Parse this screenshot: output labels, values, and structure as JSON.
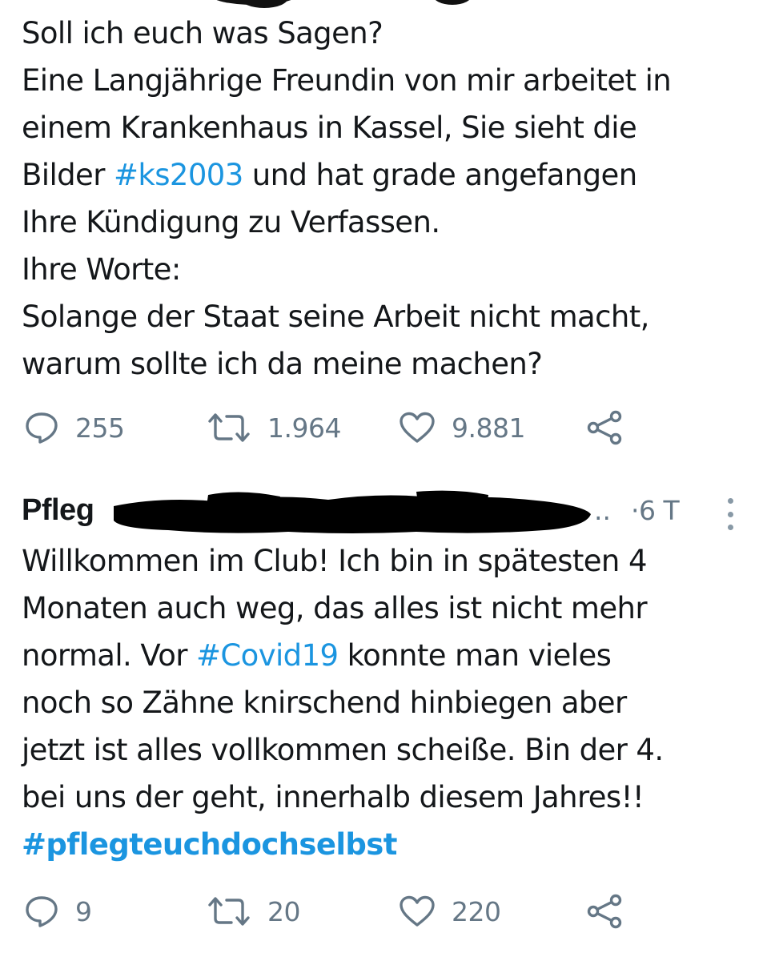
{
  "tweet1": {
    "text_lines": [
      "Soll ich euch was Sagen?",
      "Eine Langjährige Freundin von mir arbeitet in",
      "einem Krankenhaus in Kassel, Sie sieht die",
      "Bilder ",
      "#ks2003",
      " und hat grade angefangen",
      "Ihre Kündigung zu Verfassen.",
      "Ihre Worte:",
      "Solange der Staat seine Arbeit nicht macht,",
      "warum sollte ich da meine machen?"
    ],
    "hashtag": "#ks2003",
    "replies": "255",
    "retweets": "1.964",
    "likes": "9.881"
  },
  "tweet2": {
    "author": "Pfleg",
    "ellipsis": "..",
    "time": "·6 T",
    "text_lines": [
      "Willkommen im Club! Ich bin in spätesten 4",
      "Monaten auch weg, das alles ist nicht mehr",
      "normal. Vor ",
      "#Covid19",
      " konnte man vieles",
      "noch so Zähne knirschend hinbiegen aber",
      "jetzt ist alles vollkommen scheiße. Bin der 4.",
      "bei uns der geht, innerhalb diesem Jahres!!",
      "#pflegteuchdochselbst"
    ],
    "replies": "9",
    "retweets": "20",
    "likes": "220"
  },
  "icons": {
    "reply": "reply-icon",
    "retweet": "retweet-icon",
    "like": "heart-icon",
    "share": "share-icon",
    "more": "more-vertical-icon"
  },
  "colors": {
    "text": "#14171a",
    "hashtag": "#1b95e0",
    "muted": "#657786",
    "redaction": "#000000"
  }
}
